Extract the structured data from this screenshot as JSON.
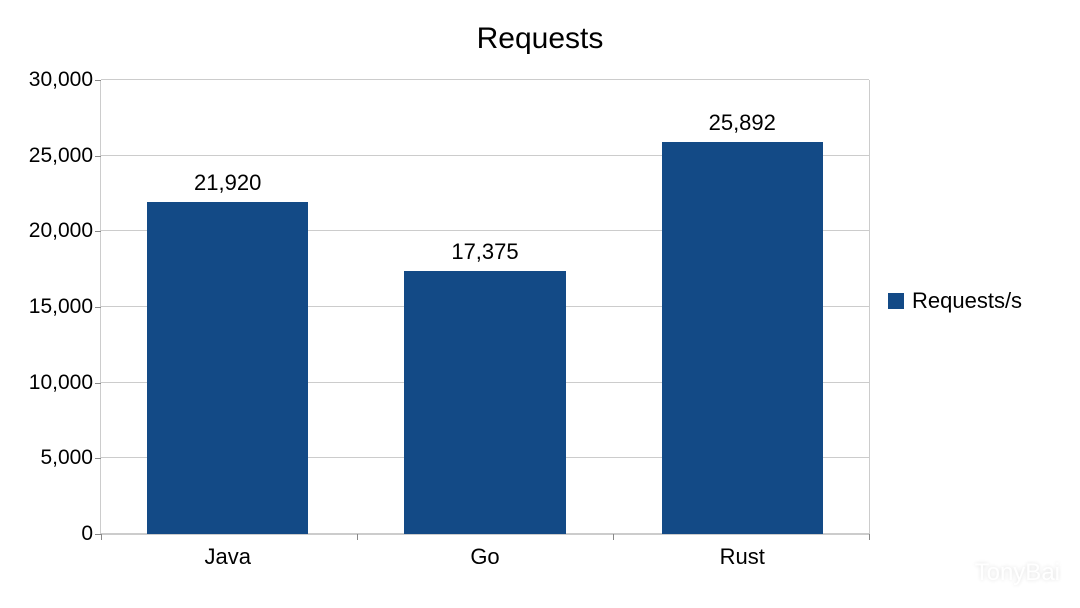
{
  "chart_data": {
    "type": "bar",
    "title": "Requests",
    "categories": [
      "Java",
      "Go",
      "Rust"
    ],
    "series": [
      {
        "name": "Requests/s",
        "values": [
          21920,
          17375,
          25892
        ]
      }
    ],
    "data_labels": [
      "21,920",
      "17,375",
      "25,892"
    ],
    "ylim": [
      0,
      30000
    ],
    "y_ticks": [
      0,
      5000,
      10000,
      15000,
      20000,
      25000,
      30000
    ],
    "y_tick_labels": [
      "0",
      "5,000",
      "10,000",
      "15,000",
      "20,000",
      "25,000",
      "30,000"
    ],
    "grid": true,
    "legend_position": "right",
    "bar_color": "#134a86"
  },
  "watermark": {
    "text": "TonyBai"
  }
}
